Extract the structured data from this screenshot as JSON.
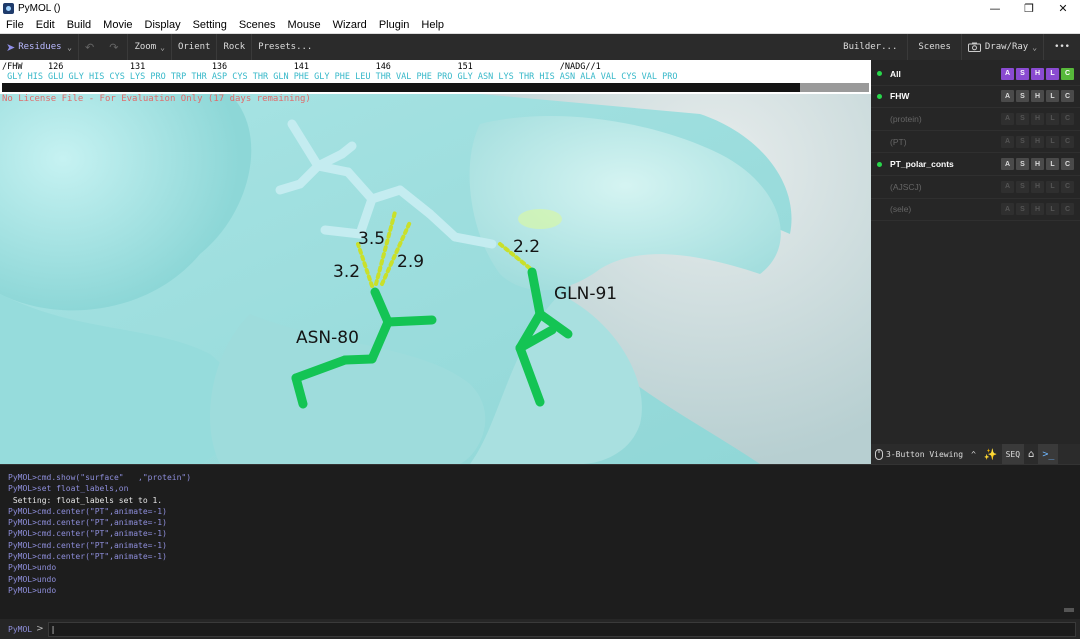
{
  "window": {
    "title": "PyMOL ()",
    "controls": [
      "—",
      "❐",
      "✕"
    ]
  },
  "menu": [
    "File",
    "Edit",
    "Build",
    "Movie",
    "Display",
    "Setting",
    "Scenes",
    "Mouse",
    "Wizard",
    "Plugin",
    "Help"
  ],
  "toolbar": {
    "mode_label": "Residues",
    "undo_glyph": "↶",
    "redo_glyph": "↷",
    "zoom": "Zoom",
    "orient": "Orient",
    "rock": "Rock",
    "presets": "Presets...",
    "builder": "Builder...",
    "scenes": "Scenes",
    "draw_ray": "Draw/Ray",
    "more": "•••"
  },
  "sequence": {
    "numbers_line": "/FHW     126             131             136             141             146             151                 /NADG//1",
    "residues_line": " GLY HIS GLU GLY HIS CYS LYS PRO TRP THR ASP CYS THR GLN PHE GLY PHE LEU THR VAL PHE PRO GLY ASN LYS THR HIS ASN ALA VAL CYS VAL PRO",
    "scroll_fraction": 0.92
  },
  "viewport": {
    "license_text": "No License File - For Evaluation Only (17 days remaining)",
    "labels": {
      "d1": "3.5",
      "d2": "2.9",
      "d3": "3.2",
      "d4": "2.2",
      "res1": "ASN-80",
      "res2": "GLN-91"
    },
    "colors": {
      "surface": "#9fe3e3",
      "ligand": "#c4ecf0",
      "residues": "#14c454",
      "hbond": "#c9e02a"
    }
  },
  "objects": [
    {
      "name": "All",
      "enabled": true
    },
    {
      "name": "FHW",
      "enabled": true
    },
    {
      "name": "(protein)",
      "enabled": false
    },
    {
      "name": "(PT)",
      "enabled": false
    },
    {
      "name": "PT_polar_conts",
      "enabled": true
    },
    {
      "name": "(AJSCJ)",
      "enabled": false
    },
    {
      "name": "(sele)",
      "enabled": false
    }
  ],
  "button_letters": [
    "A",
    "S",
    "H",
    "L",
    "C"
  ],
  "all_button_colors": [
    "#8a4bd1",
    "#8a4bd1",
    "#8a4bd1",
    "#8a4bd1",
    "#57b83a"
  ],
  "statusbar": {
    "viewing": "3-Button Viewing",
    "caret": "^",
    "seq": "SEQ"
  },
  "console": [
    {
      "t": "cmd",
      "s": "PyMOL>cmd.show(\"surface\"   ,\"protein\")"
    },
    {
      "t": "cmd",
      "s": "PyMOL>set float_labels,on"
    },
    {
      "t": "out",
      "s": " Setting: float_labels set to 1."
    },
    {
      "t": "cmd",
      "s": "PyMOL>cmd.center(\"PT\",animate=-1)"
    },
    {
      "t": "cmd",
      "s": "PyMOL>cmd.center(\"PT\",animate=-1)"
    },
    {
      "t": "cmd",
      "s": "PyMOL>cmd.center(\"PT\",animate=-1)"
    },
    {
      "t": "cmd",
      "s": "PyMOL>cmd.center(\"PT\",animate=-1)"
    },
    {
      "t": "cmd",
      "s": "PyMOL>cmd.center(\"PT\",animate=-1)"
    },
    {
      "t": "cmd",
      "s": "PyMOL>undo"
    },
    {
      "t": "cmd",
      "s": "PyMOL>undo"
    },
    {
      "t": "cmd",
      "s": "PyMOL>undo"
    }
  ],
  "prompt": {
    "label": "PyMOL",
    "chevron": ">",
    "value": "|"
  }
}
